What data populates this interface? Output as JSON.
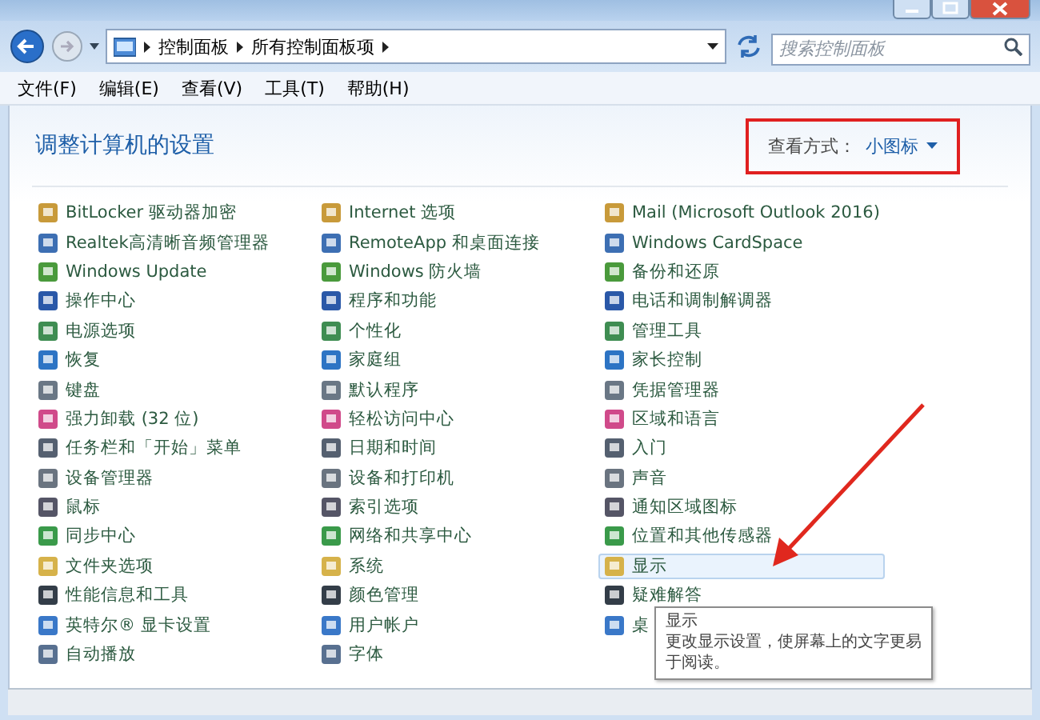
{
  "address_bar": {
    "breadcrumbs": [
      "控制面板",
      "所有控制面板项"
    ]
  },
  "search": {
    "placeholder": "搜索控制面板"
  },
  "menu": [
    "文件(F)",
    "编辑(E)",
    "查看(V)",
    "工具(T)",
    "帮助(H)"
  ],
  "heading": "调整计算机的设置",
  "view_by": {
    "label": "查看方式：",
    "value": "小图标",
    "highlighted": true
  },
  "columns": [
    [
      {
        "label": "BitLocker 驱动器加密",
        "hovered": false
      },
      {
        "label": "Realtek高清晰音频管理器",
        "hovered": false
      },
      {
        "label": "Windows Update",
        "hovered": false
      },
      {
        "label": "操作中心",
        "hovered": false
      },
      {
        "label": "电源选项",
        "hovered": false
      },
      {
        "label": "恢复",
        "hovered": false
      },
      {
        "label": "键盘",
        "hovered": false
      },
      {
        "label": "强力卸载 (32 位)",
        "hovered": false
      },
      {
        "label": "任务栏和「开始」菜单",
        "hovered": false
      },
      {
        "label": "设备管理器",
        "hovered": false
      },
      {
        "label": "鼠标",
        "hovered": false
      },
      {
        "label": "同步中心",
        "hovered": false
      },
      {
        "label": "文件夹选项",
        "hovered": false
      },
      {
        "label": "性能信息和工具",
        "hovered": false
      },
      {
        "label": "英特尔® 显卡设置",
        "hovered": false
      },
      {
        "label": "自动播放",
        "hovered": false
      }
    ],
    [
      {
        "label": "Internet 选项",
        "hovered": false
      },
      {
        "label": "RemoteApp 和桌面连接",
        "hovered": false
      },
      {
        "label": "Windows 防火墙",
        "hovered": false
      },
      {
        "label": "程序和功能",
        "hovered": false
      },
      {
        "label": "个性化",
        "hovered": false
      },
      {
        "label": "家庭组",
        "hovered": false
      },
      {
        "label": "默认程序",
        "hovered": false
      },
      {
        "label": "轻松访问中心",
        "hovered": false
      },
      {
        "label": "日期和时间",
        "hovered": false
      },
      {
        "label": "设备和打印机",
        "hovered": false
      },
      {
        "label": "索引选项",
        "hovered": false
      },
      {
        "label": "网络和共享中心",
        "hovered": false
      },
      {
        "label": "系统",
        "hovered": false
      },
      {
        "label": "颜色管理",
        "hovered": false
      },
      {
        "label": "用户帐户",
        "hovered": false
      },
      {
        "label": "字体",
        "hovered": false
      }
    ],
    [
      {
        "label": "Mail (Microsoft Outlook 2016)",
        "hovered": false
      },
      {
        "label": "Windows CardSpace",
        "hovered": false
      },
      {
        "label": "备份和还原",
        "hovered": false
      },
      {
        "label": "电话和调制解调器",
        "hovered": false
      },
      {
        "label": "管理工具",
        "hovered": false
      },
      {
        "label": "家长控制",
        "hovered": false
      },
      {
        "label": "凭据管理器",
        "hovered": false
      },
      {
        "label": "区域和语言",
        "hovered": false
      },
      {
        "label": "入门",
        "hovered": false
      },
      {
        "label": "声音",
        "hovered": false
      },
      {
        "label": "通知区域图标",
        "hovered": false
      },
      {
        "label": "位置和其他传感器",
        "hovered": false
      },
      {
        "label": "显示",
        "hovered": true
      },
      {
        "label": "疑难解答",
        "hovered": false
      },
      {
        "label": "桌",
        "hovered": false
      }
    ]
  ],
  "tooltip": {
    "title": "显示",
    "lines": [
      "更改显示设置，使屏幕上的文字更易",
      "于阅读。"
    ]
  },
  "pointer_arrow": true
}
